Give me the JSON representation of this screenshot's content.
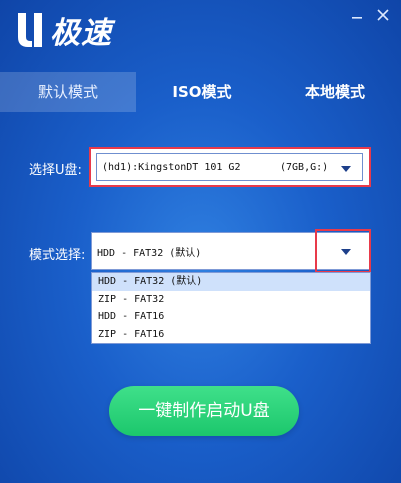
{
  "header": {
    "logo_text": "极速",
    "minimize_icon": "minimize-icon",
    "close_icon": "close-icon"
  },
  "tabs": [
    {
      "label": "默认模式",
      "active": true
    },
    {
      "label": "ISO模式",
      "active": false
    },
    {
      "label": "本地模式",
      "active": false
    }
  ],
  "usb": {
    "label": "选择U盘:",
    "device": "(hd1):KingstonDT 101 G2",
    "size": "(7GB,G:)"
  },
  "mode": {
    "label": "模式选择:",
    "selected": "HDD - FAT32 (默认)",
    "options": [
      "HDD - FAT32 (默认)",
      "ZIP - FAT32",
      "HDD - FAT16",
      "ZIP - FAT16"
    ]
  },
  "actions": {
    "make_boot_label": "一键制作启动U盘"
  },
  "colors": {
    "accent_green": "#1cc76c",
    "highlight_red": "#e83a4a",
    "background_blue": "#1a5fca"
  }
}
